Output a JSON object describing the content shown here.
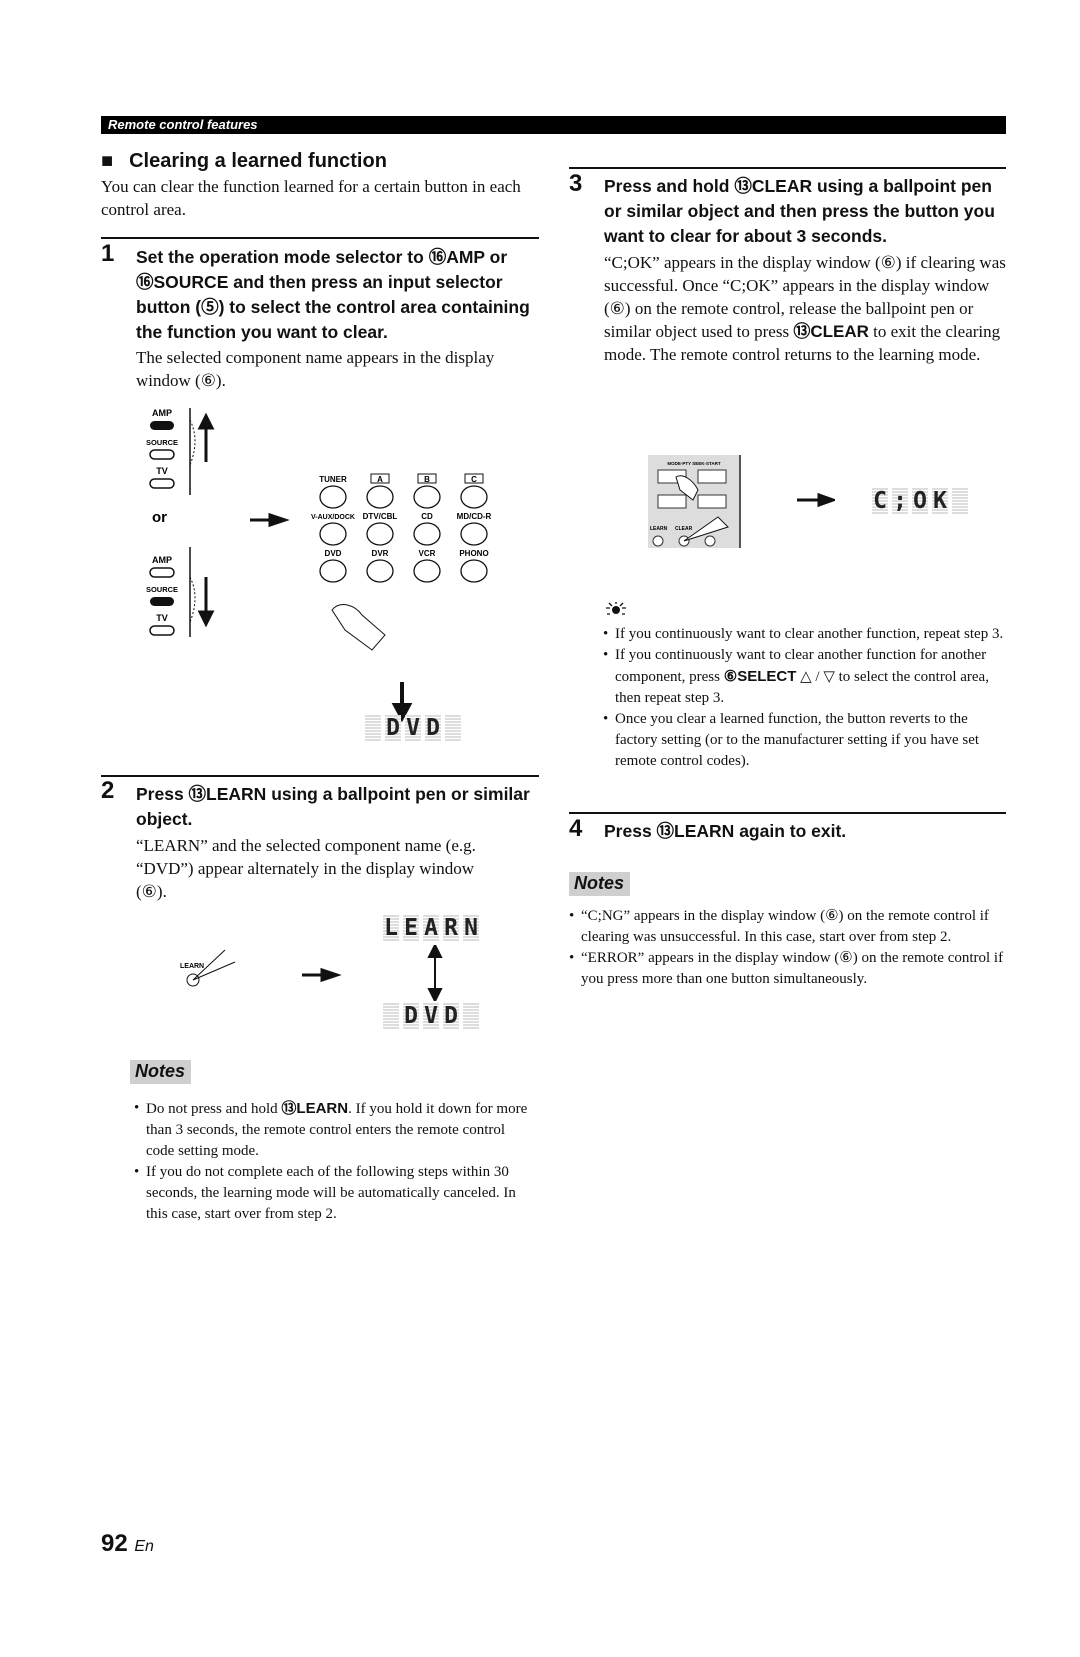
{
  "header": {
    "section": "Remote control features"
  },
  "section": {
    "title": "Clearing a learned function",
    "intro": "You can clear the function learned for a certain button in each control area."
  },
  "step1": {
    "num": "1",
    "t1": "Set the operation mode selector to ",
    "c1": "⑯",
    "k1": "AMP",
    "t2": " or ",
    "c2": "⑯",
    "k2": "SOURCE",
    "t3": " and then press an input selector button (⑤) to select the control area containing the function you want to clear.",
    "body": "The selected component name appears in the display window (⑥).",
    "figure": {
      "modes": [
        "AMP",
        "SOURCE",
        "TV"
      ],
      "or": "or",
      "buttons": [
        "TUNER",
        "A",
        "B",
        "C",
        "V-AUX/DOCK",
        "DTV/CBL",
        "CD",
        "MD/CD-R",
        "DVD",
        "DVR",
        "VCR",
        "PHONO"
      ],
      "display": [
        "",
        "D",
        "V",
        "D",
        ""
      ]
    }
  },
  "step2": {
    "num": "2",
    "t1": "Press ",
    "c1": "⑬",
    "k1": "LEARN",
    "t2": " using a ballpoint pen or similar object.",
    "body": "“LEARN” and the selected component name (e.g. “DVD”) appear alternately in the display window (⑥).",
    "figure": {
      "button_label": "LEARN",
      "display_a": [
        "L",
        "E",
        "A",
        "R",
        "N"
      ],
      "display_b": [
        "",
        "D",
        "V",
        "D",
        ""
      ]
    }
  },
  "notes_left": {
    "label": "Notes",
    "items": [
      {
        "a": "Do not press and hold ",
        "c": "⑬",
        "k": "LEARN",
        "b": ". If you hold it down for more than 3 seconds, the remote control enters the remote control code setting mode."
      },
      {
        "a": "If you do not complete each of the following steps within 30 seconds, the learning mode will be automatically canceled. In this case, start over from step 2."
      }
    ]
  },
  "step3": {
    "num": "3",
    "t1": "Press and hold ",
    "c1": "⑬",
    "k1": "CLEAR",
    "t2": " using a ballpoint pen or similar object and then press the button you want to clear for about 3 seconds.",
    "b1": "“C;OK” appears in the display window (⑥) if clearing was successful. Once “C;OK” appears in the display window (⑥) on the remote control, release the ballpoint pen or similar object used to press ",
    "bc": "⑬",
    "bk": "CLEAR",
    "b2": " to exit the clearing mode. The remote control returns to the learning mode.",
    "figure": {
      "panel_label": "MODE-PTY SEEK-START",
      "labels": [
        "LEARN",
        "CLEAR"
      ],
      "display": [
        "C",
        ";",
        "O",
        "K",
        ""
      ]
    }
  },
  "tips": {
    "icon": "lightbulb-icon",
    "items": [
      {
        "a": "If you continuously want to clear another function, repeat step 3."
      },
      {
        "a": "If you continuously want to clear another function for another component, press ",
        "c": "⑥",
        "k": "SELECT",
        "b": " △ / ▽ to select the control area, then repeat step 3."
      },
      {
        "a": "Once you clear a learned function, the button reverts to the factory setting (or to the manufacturer setting if you have set remote control codes)."
      }
    ]
  },
  "step4": {
    "num": "4",
    "t1": "Press ",
    "c1": "⑬",
    "k1": "LEARN",
    "t2": " again to exit."
  },
  "notes_right": {
    "label": "Notes",
    "items": [
      {
        "a": "“C;NG” appears in the display window (⑥) on the remote control if clearing was unsuccessful. In this case, start over from step 2."
      },
      {
        "a": "“ERROR” appears in the display window (⑥) on the remote control if you press more than one button simultaneously."
      }
    ]
  },
  "footer": {
    "page": "92",
    "lang": "En"
  }
}
